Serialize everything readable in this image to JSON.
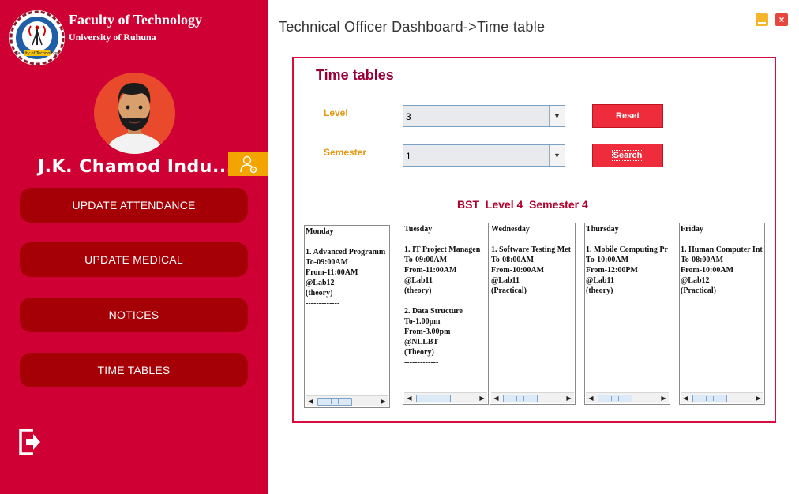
{
  "window": {
    "title": "Technical Officer Dashboard->Time table"
  },
  "sidebar": {
    "faculty_title": "Faculty of Technology",
    "faculty_subtitle": "University of Ruhuna",
    "logo_text": "Faculty of Technology",
    "user_name": "J.K. Chamod Indu...",
    "nav": [
      {
        "label": "UPDATE ATTENDANCE"
      },
      {
        "label": "UPDATE MEDICAL"
      },
      {
        "label": "NOTICES"
      },
      {
        "label": "TIME TABLES"
      }
    ]
  },
  "form": {
    "title": "Time tables",
    "level_label": "Level",
    "level_value": "3",
    "semester_label": "Semester",
    "semester_value": "1",
    "reset_label": "Reset",
    "search_label": "Search"
  },
  "timetable": {
    "heading": "BST  Level 4  Semester 4",
    "days": [
      {
        "name": "Monday",
        "lines": [
          "",
          "1. Advanced Programm",
          "To-09:00AM",
          "From-11:00AM",
          "@Lab12",
          "(theory)",
          "-------------"
        ]
      },
      {
        "name": "Tuesday",
        "lines": [
          "",
          "1. IT Project Managen",
          "To-09:00AM",
          "From-11:00AM",
          "@Lab11",
          "(theory)",
          "-------------",
          "2. Data Structure",
          "To-1.00pm",
          "From-3.00pm",
          "@NLLBT",
          "(Theory)",
          "-------------"
        ]
      },
      {
        "name": "Wednesday",
        "lines": [
          "",
          "1. Software Testing Met",
          "To-08:00AM",
          "From-10:00AM",
          "@Lab11",
          "(Practical)",
          "-------------"
        ]
      },
      {
        "name": "Thursday",
        "lines": [
          "",
          "1. Mobile Computing Pr",
          "To-10:00AM",
          "From-12:00PM",
          "@Lab11",
          "(theory)",
          "-------------"
        ]
      },
      {
        "name": "Friday",
        "lines": [
          "",
          "1. Human Computer Int",
          "To-08:00AM",
          "From-10:00AM",
          "@Lab12",
          "(Practical)",
          "-------------"
        ]
      }
    ]
  },
  "colors": {
    "sidebar": "#cf0033",
    "nav_button": "#a60007",
    "accent_orange": "#f4a400",
    "panel_border": "#d80b3c",
    "title_maroon": "#9a0036",
    "label_orange": "#e6960f",
    "action_button": "#ee2c3c"
  },
  "icons": {
    "logo": "faculty-logo-icon",
    "avatar": "user-avatar-icon",
    "profile": "user-settings-icon",
    "logout": "logout-icon",
    "minimize": "minimize-icon",
    "close": "close-icon",
    "dropdown": "chevron-down-icon"
  }
}
